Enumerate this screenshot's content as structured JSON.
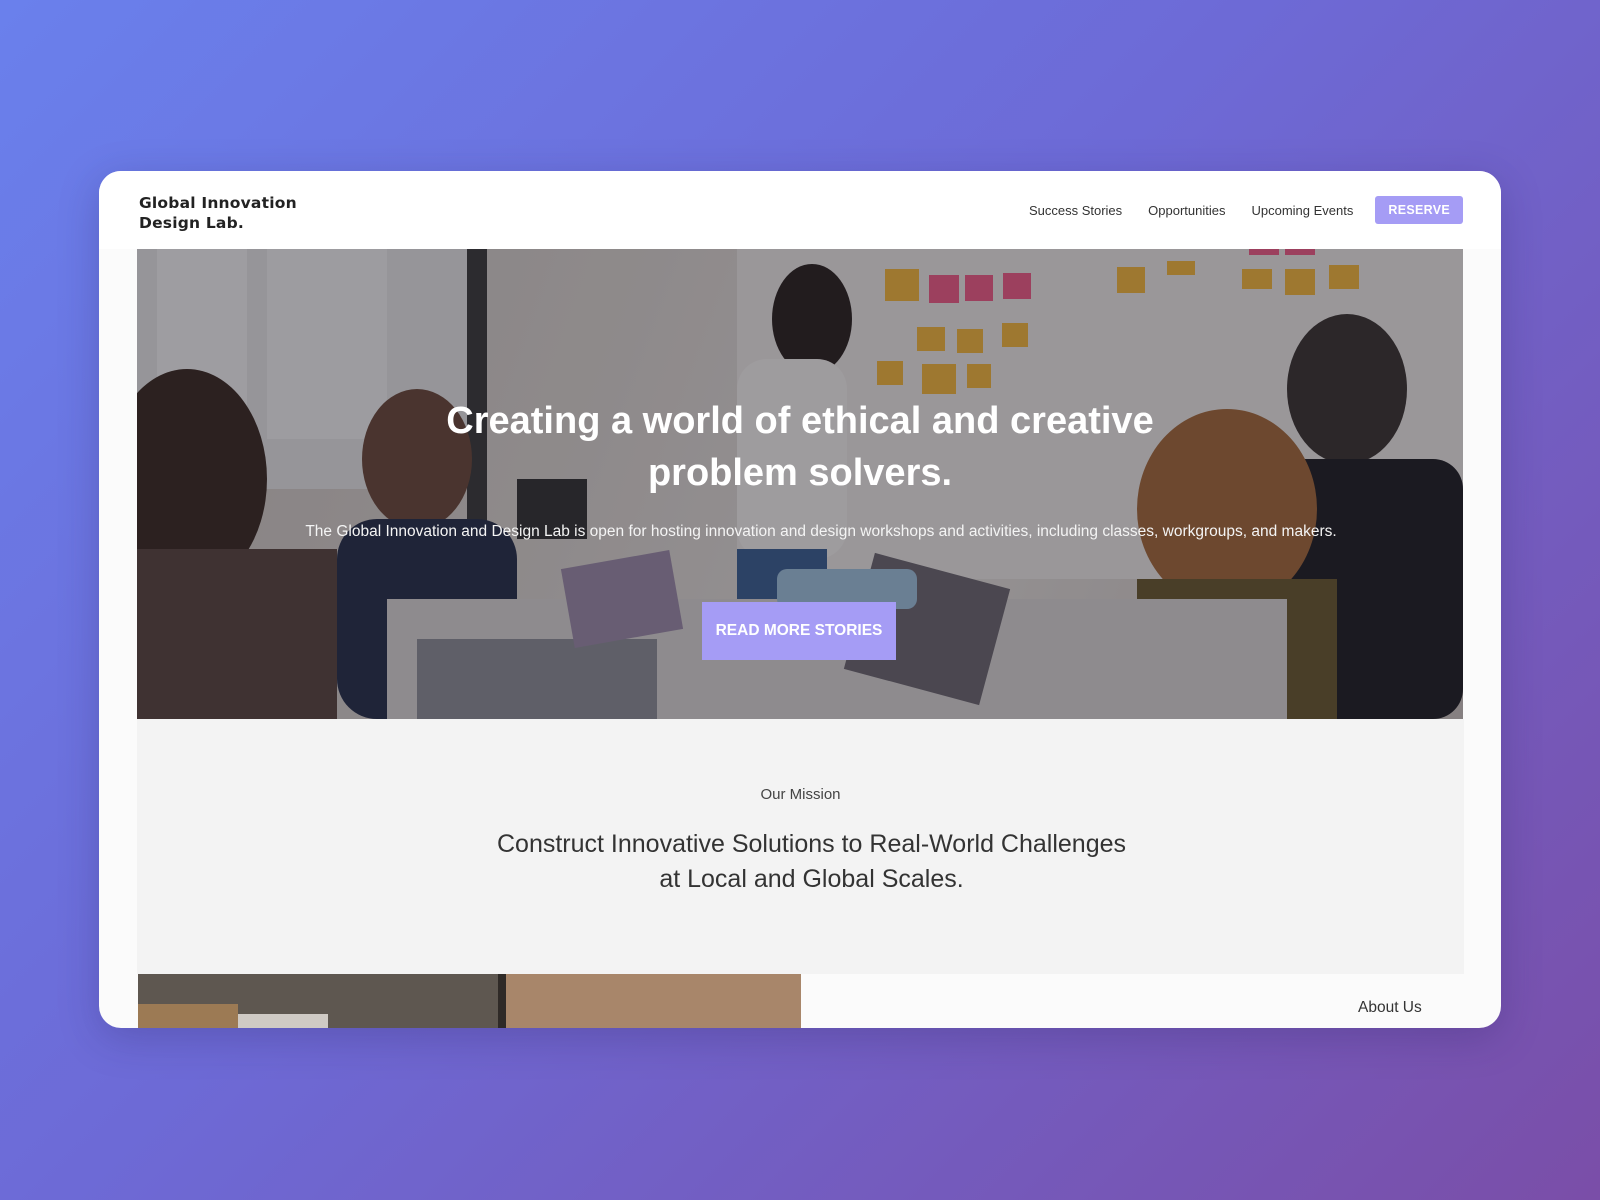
{
  "header": {
    "logo_line1": "Global Innovation",
    "logo_line2": "Design Lab.",
    "nav": {
      "success_stories": "Success Stories",
      "opportunities": "Opportunities",
      "upcoming_events": "Upcoming Events"
    },
    "reserve_label": "RESERVE"
  },
  "hero": {
    "title_line1": "Creating a world of ethical and creative",
    "title_line2": "problem solvers.",
    "subtitle": "The Global Innovation and Design Lab is open for hosting innovation and design workshops and activities, including classes, workgroups, and makers.",
    "button_label": "READ MORE STORIES"
  },
  "mission": {
    "eyebrow": "Our Mission",
    "title_line1": "Construct Innovative Solutions to Real-World Challenges",
    "title_line2": "at Local and Global Scales."
  },
  "about": {
    "label": "About Us"
  },
  "colors": {
    "accent": "#a59cf5",
    "background_gradient_start": "#6a80ec",
    "background_gradient_end": "#7a4ea8"
  }
}
